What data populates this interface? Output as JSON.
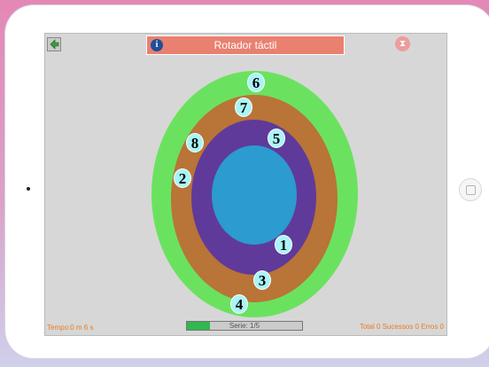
{
  "header": {
    "title": "Rotador táctil"
  },
  "icons": {
    "back": "back-arrow-icon",
    "info": "info-icon",
    "timer": "hourglass-icon"
  },
  "board": {
    "ring_colors": [
      "#6be25f",
      "#b97437",
      "#5f3a9a",
      "#2b9bd0"
    ],
    "chips": [
      {
        "label": "6"
      },
      {
        "label": "7"
      },
      {
        "label": "8"
      },
      {
        "label": "5"
      },
      {
        "label": "2"
      },
      {
        "label": "1"
      },
      {
        "label": "3"
      },
      {
        "label": "4"
      }
    ]
  },
  "footer": {
    "time": "Tempo:0 m 6 s",
    "series": "Serie: 1/5",
    "series_progress": 0.2,
    "score": "Total 0 Sucessos 0 Erros 0"
  },
  "info_glyph": "i",
  "hourglass_glyph": "⧗"
}
